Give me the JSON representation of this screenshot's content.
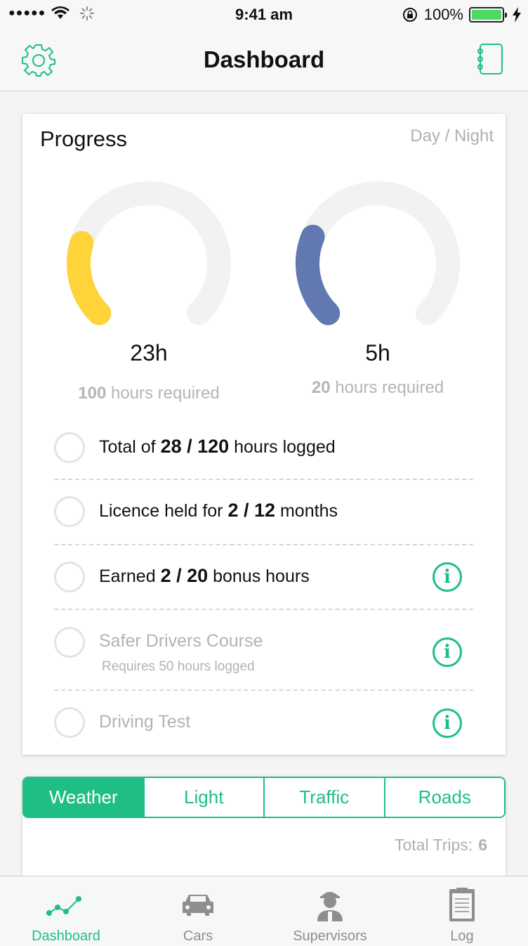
{
  "status_bar": {
    "signal": "●●●●●",
    "time": "9:41 am",
    "battery_percent": "100%",
    "icons": [
      "wifi-icon",
      "activity-spinner-icon",
      "rotation-lock-icon",
      "battery-icon",
      "charging-bolt-icon"
    ]
  },
  "nav": {
    "title": "Dashboard",
    "left_icon": "gear-icon",
    "right_icon": "notebook-icon"
  },
  "progress": {
    "title": "Progress",
    "toggle_label": "Day / Night",
    "day": {
      "value": "23h",
      "required_number": "100",
      "required_text": "hours required",
      "fraction": 0.23,
      "color": "#ffd43b"
    },
    "night": {
      "value": "5h",
      "required_number": "20",
      "required_text": "hours required",
      "fraction": 0.25,
      "color": "#6179b0"
    },
    "track_color": "#f2f2f2",
    "items": [
      {
        "prefix": "Total of",
        "bold": "28 / 120",
        "suffix": "hours logged",
        "enabled": true,
        "has_info": false
      },
      {
        "prefix": "Licence held for",
        "bold": "2 / 12",
        "suffix": "months",
        "enabled": true,
        "has_info": false
      },
      {
        "prefix": "Earned",
        "bold": "2 / 20",
        "suffix": "bonus hours",
        "enabled": true,
        "has_info": true
      },
      {
        "label": "Safer Drivers Course",
        "sub": "Requires 50 hours logged",
        "enabled": false,
        "has_info": true
      },
      {
        "label": "Driving Test",
        "enabled": false,
        "has_info": true
      }
    ],
    "info_glyph": "i"
  },
  "segments": {
    "tabs": [
      "Weather",
      "Light",
      "Traffic",
      "Roads"
    ],
    "active": "Weather",
    "total_trips_label": "Total Trips:",
    "total_trips_value": "6"
  },
  "tab_bar": {
    "items": [
      {
        "label": "Dashboard",
        "icon": "line-chart-icon",
        "active": true
      },
      {
        "label": "Cars",
        "icon": "car-icon",
        "active": false
      },
      {
        "label": "Supervisors",
        "icon": "supervisor-icon",
        "active": false
      },
      {
        "label": "Log",
        "icon": "clipboard-icon",
        "active": false
      }
    ]
  },
  "colors": {
    "accent": "#1fbe85",
    "inactive_tab": "#8e8e8e",
    "muted_text": "#b3b3b3"
  }
}
